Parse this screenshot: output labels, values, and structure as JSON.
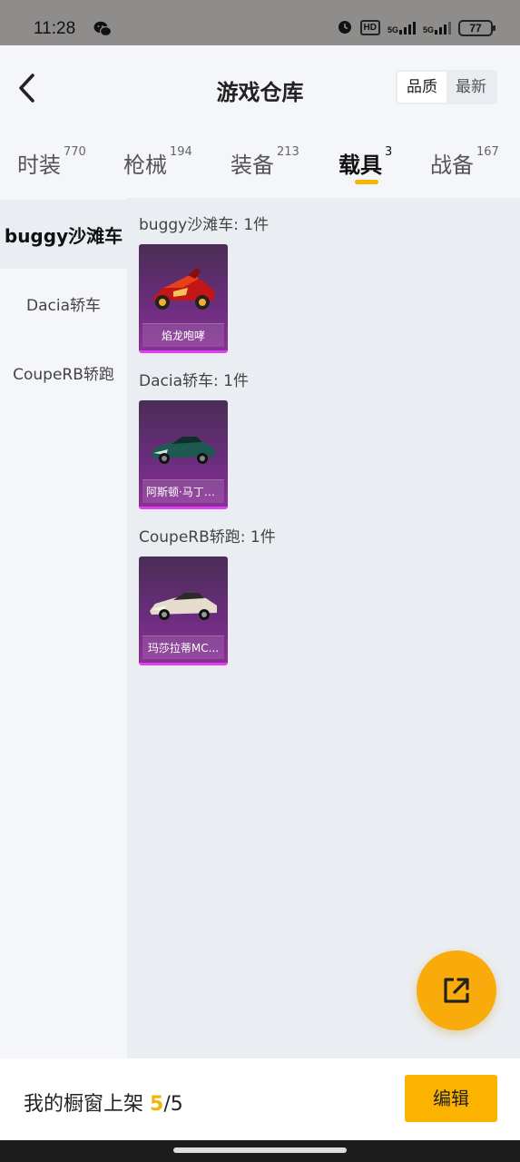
{
  "status_bar": {
    "time": "11:28",
    "battery": "77",
    "hd": "HD",
    "net1": "5G",
    "net2": "5G"
  },
  "header": {
    "title": "游戏仓库",
    "sort_options": [
      "品质",
      "最新"
    ],
    "sort_selected": "品质"
  },
  "tabs": [
    {
      "label": "时装",
      "count": "770"
    },
    {
      "label": "枪械",
      "count": "194"
    },
    {
      "label": "装备",
      "count": "213"
    },
    {
      "label": "载具",
      "count": "3",
      "active": true
    },
    {
      "label": "战备",
      "count": "167"
    }
  ],
  "sidebar": {
    "items": [
      {
        "label": "buggy沙滩车",
        "active": true
      },
      {
        "label": "Dacia轿车"
      },
      {
        "label": "CoupeRB轿跑"
      }
    ]
  },
  "groups": [
    {
      "title": "buggy沙滩车: 1件",
      "items": [
        {
          "name": "焰龙咆哮",
          "icon": "red-buggy-image"
        }
      ]
    },
    {
      "title": "Dacia轿车: 1件",
      "items": [
        {
          "name": "阿斯顿·马丁D...",
          "icon": "green-sports-car-image"
        }
      ]
    },
    {
      "title": "CoupeRB轿跑: 1件",
      "items": [
        {
          "name": "玛莎拉蒂MC...",
          "icon": "white-supercar-image"
        }
      ]
    }
  ],
  "bottom_bar": {
    "label": "我的橱窗上架",
    "count": "5",
    "total": "/5",
    "edit_button": "编辑"
  },
  "colors": {
    "accent": "#f5b400",
    "card_bg": "#6a2d7c",
    "card_border": "#e040f2"
  }
}
